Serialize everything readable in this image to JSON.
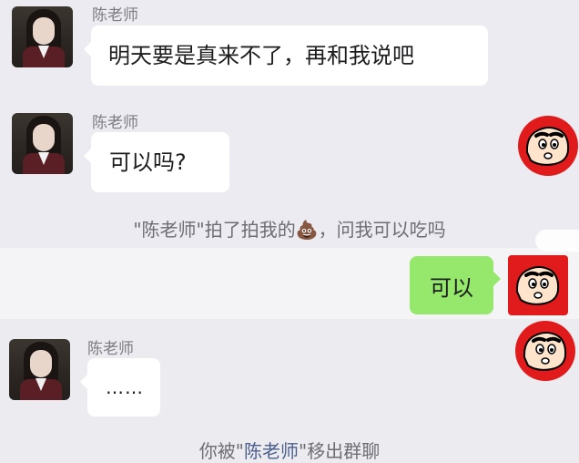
{
  "messages": [
    {
      "sender": "陈老师",
      "text": "明天要是真来不了，再和我说吧"
    },
    {
      "sender": "陈老师",
      "text": "可以吗?"
    }
  ],
  "pat_notice": {
    "before": "\"陈老师\"拍了拍我的",
    "emoji": "💩",
    "after": "，问我可以吃吗"
  },
  "self_message": {
    "text": "可以"
  },
  "last_message": {
    "sender": "陈老师",
    "text": "……"
  },
  "removal_notice": {
    "prefix": "你被\"",
    "name": "陈老师",
    "suffix": "\"移出群聊"
  },
  "colors": {
    "self_bubble": "#95e86c",
    "avatar_red": "#e11b1b",
    "highlight_name": "#4a5f8c"
  }
}
